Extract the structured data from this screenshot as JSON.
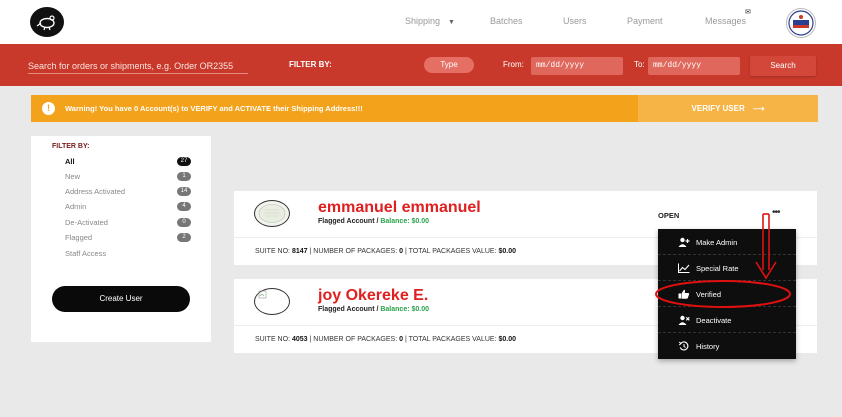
{
  "nav": {
    "items": [
      {
        "label": "Shipping"
      },
      {
        "label": "Batches"
      },
      {
        "label": "Users"
      },
      {
        "label": "Payment"
      },
      {
        "label": "Messages"
      }
    ]
  },
  "search": {
    "placeholder": "Search for orders or shipments, e.g. Order OR2355",
    "filter_label": "FILTER BY:",
    "type_label": "Type",
    "from_label": "From:",
    "from_value": "mm/dd/yyyy",
    "to_label": "To:",
    "to_value": "mm/dd/yyyy",
    "button_label": "Search"
  },
  "warning": {
    "text": "Warning! You have 0 Account(s) to VERIFY and ACTIVATE their Shipping Address!!!",
    "button_label": "VERIFY USER"
  },
  "filter_panel": {
    "title": "FILTER BY:",
    "items": [
      {
        "label": "All",
        "count": "27"
      },
      {
        "label": "New",
        "count": "1"
      },
      {
        "label": "Address Activated",
        "count": "14"
      },
      {
        "label": "Admin",
        "count": "4"
      },
      {
        "label": "De-Activated",
        "count": "0"
      },
      {
        "label": "Flagged",
        "count": "2"
      },
      {
        "label": "Staff Access",
        "count": ""
      }
    ],
    "create_button": "Create User"
  },
  "users": [
    {
      "name": "emmanuel emmanuel",
      "flag": "Flagged Account / ",
      "balance": "Balance: $0.00",
      "status": "OPEN",
      "suite_label": "SUITE NO:",
      "suite": "8147",
      "packages_label": "| NUMBER OF PACKAGES:",
      "packages": "0",
      "value_label": "| TOTAL PACKAGES VALUE:",
      "value": "$0.00"
    },
    {
      "name": "joy Okereke E.",
      "flag": "Flagged Account / ",
      "balance": "Balance: $0.00",
      "status": "",
      "suite_label": "SUITE NO:",
      "suite": "4053",
      "packages_label": "| NUMBER OF PACKAGES:",
      "packages": "0",
      "value_label": "| TOTAL PACKAGES VALUE:",
      "value": "$0.00"
    }
  ],
  "menu": {
    "items": [
      {
        "label": "Make Admin",
        "icon": "user-plus-icon"
      },
      {
        "label": "Special Rate",
        "icon": "chart-line-icon"
      },
      {
        "label": "Verified",
        "icon": "thumbs-up-icon"
      },
      {
        "label": "Deactivate",
        "icon": "user-times-icon"
      },
      {
        "label": "History",
        "icon": "history-icon"
      }
    ]
  },
  "colors": {
    "brand_red": "#c8392b",
    "warning": "#f3a21c",
    "name_red": "#e02020",
    "balance_green": "#2aa24a",
    "annotation_red": "#e01010"
  }
}
